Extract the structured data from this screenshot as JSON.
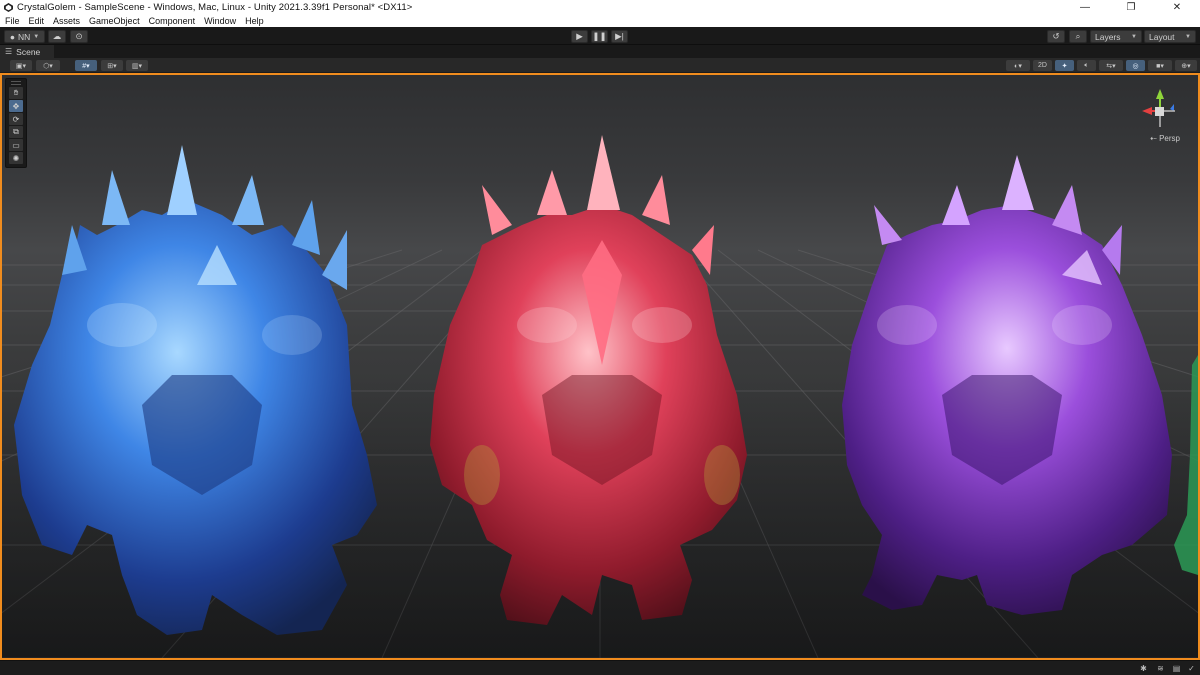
{
  "window": {
    "title": "CrystalGolem - SampleScene - Windows, Mac, Linux - Unity 2021.3.39f1 Personal* <DX11>",
    "controls": [
      "minimize-icon",
      "restore-icon",
      "close-icon"
    ]
  },
  "menu": {
    "items": [
      "File",
      "Edit",
      "Assets",
      "GameObject",
      "Component",
      "Window",
      "Help"
    ]
  },
  "toolbar": {
    "account_label": "NN",
    "play_icon": "play-icon",
    "pause_icon": "pause-icon",
    "step_icon": "step-icon",
    "layers_label": "Layers",
    "layout_label": "Layout"
  },
  "scene_tab": {
    "label": "Scene"
  },
  "scene_toolbar": {
    "mode_2d_label": "2D"
  },
  "viewport": {
    "projection_label": "Persp",
    "selection_outline_color": "#f08c1e",
    "golems": [
      {
        "name": "blue",
        "color": "#3f86e6"
      },
      {
        "name": "red",
        "color": "#e0415a"
      },
      {
        "name": "purple",
        "color": "#9b4fdc"
      }
    ]
  },
  "tools": [
    "hand-tool",
    "move-tool",
    "rotate-tool",
    "scale-tool",
    "rect-tool",
    "transform-tool"
  ],
  "colors": {
    "accent_orange": "#f08c1e",
    "active_blue": "#46607c",
    "gizmo_x": "#e34040",
    "gizmo_y": "#8ed43a",
    "gizmo_z": "#3b7ce8"
  }
}
